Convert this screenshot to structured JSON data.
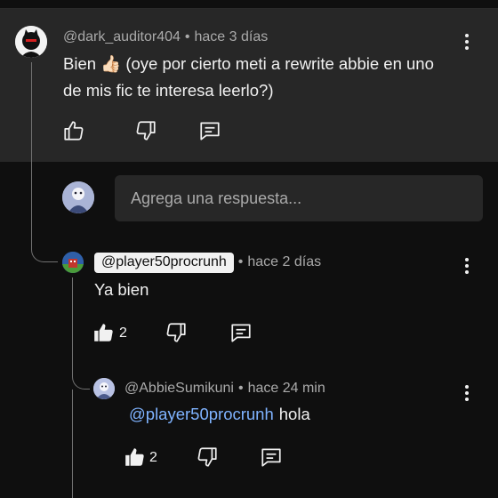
{
  "comment": {
    "handle": "@dark_auditor404",
    "time": "hace 3 días",
    "text": "Bien 👍🏻 (oye por cierto meti a rewrite abbie en uno de mis fic te interesa leerlo?)",
    "actions": {
      "like_icon": "thumb-up-outline-icon",
      "dislike_icon": "thumb-down-outline-icon",
      "reply_icon": "reply-bubble-icon"
    }
  },
  "reply_box": {
    "placeholder": "Agrega una respuesta..."
  },
  "replies": [
    {
      "handle": "@player50procrunh",
      "time": "hace 2 días",
      "text": "Ya bien",
      "likes": "2"
    },
    {
      "handle": "@AbbieSumikuni",
      "time": "hace 24 min",
      "mention": "@player50procrunh",
      "text": "hola",
      "likes": "2"
    }
  ],
  "separator": "•",
  "colors": {
    "background": "#0f0f0f",
    "highlight": "#272727",
    "mention": "#7fb3ff",
    "meta": "#aaaaaa"
  }
}
